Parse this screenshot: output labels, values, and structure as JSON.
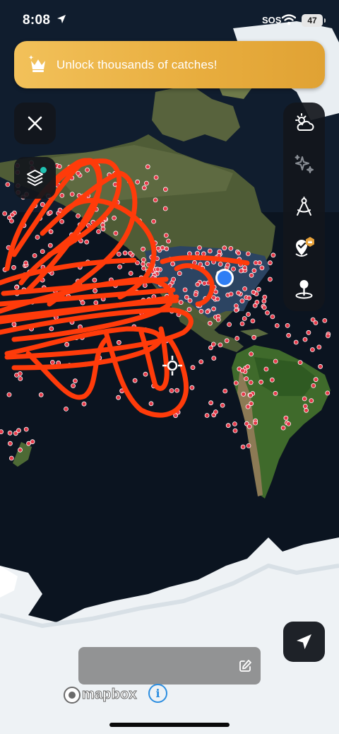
{
  "status_bar": {
    "time": "8:08",
    "location_icon": "location-arrow-icon",
    "sos": "SOS",
    "wifi_icon": "wifi-icon",
    "battery": "47"
  },
  "banner": {
    "icon": "crown-icon",
    "text": "Unlock thousands of catches!",
    "color": "#e8ad3e"
  },
  "controls": {
    "close_icon": "close-icon",
    "layers_icon": "layers-icon",
    "layers_badge_color": "#1fc2b2",
    "toolbar": [
      "weather-icon",
      "sparkles-icon",
      "compass-measure-icon",
      "premium-map-icon",
      "drop-pin-icon"
    ],
    "navigate_icon": "navigation-arrow-icon"
  },
  "map": {
    "ocean_color": "#0b1420",
    "land_color": "#4f5c36",
    "ice_color": "#f0f3f5",
    "catch_dot_color": "#e63a4a",
    "scribble_color": "#ff3b0a",
    "user_location_color": "#2f7ef5"
  },
  "note_field": {
    "edit_icon": "edit-pencil-icon"
  },
  "attribution": {
    "logo_text": "mapbox",
    "info_label": "i"
  }
}
